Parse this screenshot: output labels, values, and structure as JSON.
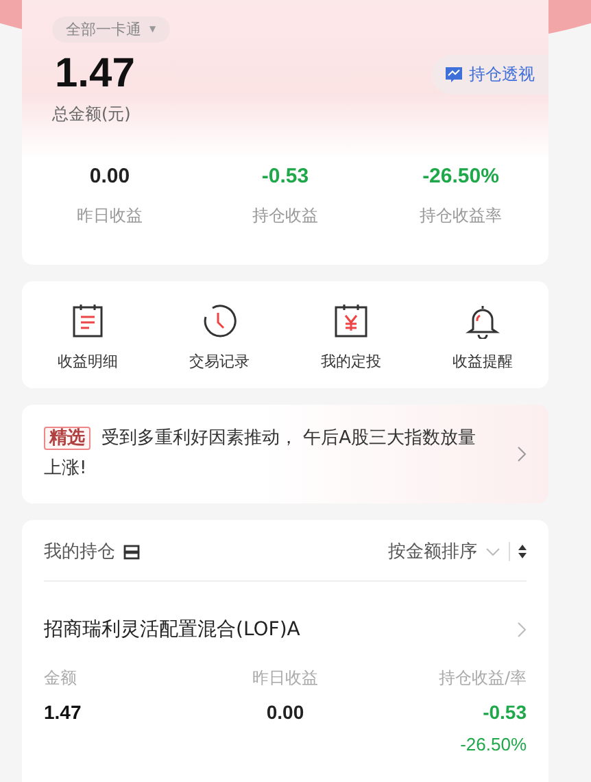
{
  "account_selector": {
    "label": "全部一卡通",
    "caret": "▼"
  },
  "summary": {
    "total": "1.47",
    "total_label": "总金额(元)",
    "insight_button": "持仓透视",
    "stats": [
      {
        "value": "0.00",
        "label": "昨日收益",
        "color": "#222222"
      },
      {
        "value": "-0.53",
        "label": "持仓收益",
        "color": "#1fa84a"
      },
      {
        "value": "-26.50%",
        "label": "持仓收益率",
        "color": "#1fa84a"
      }
    ]
  },
  "shortcuts": [
    {
      "label": "收益明细",
      "kind": "calendar"
    },
    {
      "label": "交易记录",
      "kind": "clock"
    },
    {
      "label": "我的定投",
      "kind": "yen"
    },
    {
      "label": "收益提醒",
      "kind": "bell"
    }
  ],
  "news": {
    "tag": "精选",
    "text": "受到多重利好因素推动， 午后A股三大指数放量上涨!"
  },
  "holdings": {
    "title": "我的持仓",
    "sort_label": "按金额排序",
    "funds": [
      {
        "name": "招商瑞利灵活配置混合(LOF)A",
        "columns": [
          "金额",
          "昨日收益",
          "持仓收益/率"
        ],
        "amount": "1.47",
        "yesterday": "0.00",
        "profit": "-0.53",
        "profit_rate": "-26.50%"
      }
    ]
  }
}
